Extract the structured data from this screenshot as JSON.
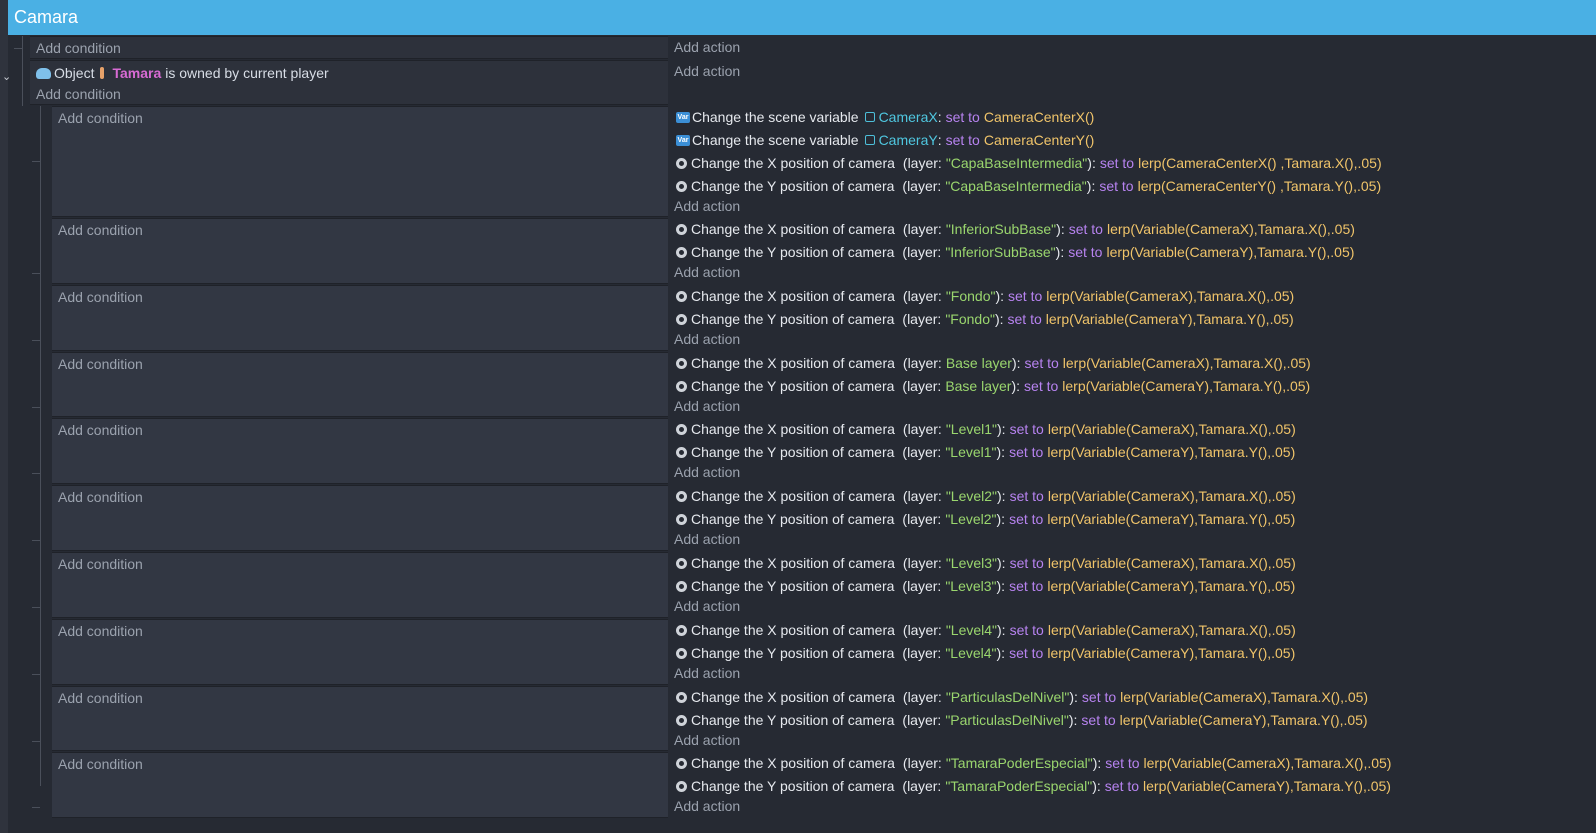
{
  "group": {
    "title": "Camara"
  },
  "labels": {
    "add_condition": "Add condition",
    "add_action": "Add action"
  },
  "icons": {
    "collapse": "chevron-down-icon",
    "object": "cloud-icon",
    "camera": "gear-icon",
    "variable": "variable-icon"
  },
  "top_event": {
    "add_condition": "Add condition",
    "add_action": "Add action"
  },
  "parent_event": {
    "condition": {
      "prefix": "Object",
      "object": "Tamara",
      "suffix": "is owned by current player"
    },
    "add_condition": "Add condition",
    "add_action": "Add action"
  },
  "sub_events": [
    {
      "actions": [
        {
          "kind": "var",
          "text": "Change the scene variable",
          "var": "CameraX",
          "set": "set to",
          "expr": "CameraCenterX()"
        },
        {
          "kind": "var",
          "text": "Change the scene variable",
          "var": "CameraY",
          "set": "set to",
          "expr": "CameraCenterY()"
        },
        {
          "kind": "cam",
          "text": "Change the X position of camera",
          "layer_pre": "(layer:",
          "layer": "\"CapaBaseIntermedia\"",
          "layer_post": "):",
          "set": "set to",
          "expr": "lerp(CameraCenterX() ,Tamara.X(),.05)"
        },
        {
          "kind": "cam",
          "text": "Change the Y position of camera",
          "layer_pre": "(layer:",
          "layer": "\"CapaBaseIntermedia\"",
          "layer_post": "):",
          "set": "set to",
          "expr": "lerp(CameraCenterY() ,Tamara.Y(),.05)"
        }
      ]
    },
    {
      "actions": [
        {
          "kind": "cam",
          "text": "Change the X position of camera",
          "layer_pre": "(layer:",
          "layer": "\"InferiorSubBase\"",
          "layer_post": "):",
          "set": "set to",
          "expr": "lerp(Variable(CameraX),Tamara.X(),.05)"
        },
        {
          "kind": "cam",
          "text": "Change the Y position of camera",
          "layer_pre": "(layer:",
          "layer": "\"InferiorSubBase\"",
          "layer_post": "):",
          "set": "set to",
          "expr": "lerp(Variable(CameraY),Tamara.Y(),.05)"
        }
      ]
    },
    {
      "actions": [
        {
          "kind": "cam",
          "text": "Change the X position of camera",
          "layer_pre": "(layer:",
          "layer": "\"Fondo\"",
          "layer_post": "):",
          "set": "set to",
          "expr": "lerp(Variable(CameraX),Tamara.X(),.05)"
        },
        {
          "kind": "cam",
          "text": "Change the Y position of camera",
          "layer_pre": "(layer:",
          "layer": "\"Fondo\"",
          "layer_post": "):",
          "set": "set to",
          "expr": "lerp(Variable(CameraY),Tamara.Y(),.05)"
        }
      ]
    },
    {
      "actions": [
        {
          "kind": "cam",
          "text": "Change the X position of camera",
          "layer_pre": "(layer:",
          "layer": "Base layer",
          "layer_post": "):",
          "set": "set to",
          "expr": "lerp(Variable(CameraX),Tamara.X(),.05)"
        },
        {
          "kind": "cam",
          "text": "Change the Y position of camera",
          "layer_pre": "(layer:",
          "layer": "Base layer",
          "layer_post": "):",
          "set": "set to",
          "expr": "lerp(Variable(CameraY),Tamara.Y(),.05)"
        }
      ]
    },
    {
      "actions": [
        {
          "kind": "cam",
          "text": "Change the X position of camera",
          "layer_pre": "(layer:",
          "layer": "\"Level1\"",
          "layer_post": "):",
          "set": "set to",
          "expr": "lerp(Variable(CameraX),Tamara.X(),.05)"
        },
        {
          "kind": "cam",
          "text": "Change the Y position of camera",
          "layer_pre": "(layer:",
          "layer": "\"Level1\"",
          "layer_post": "):",
          "set": "set to",
          "expr": "lerp(Variable(CameraY),Tamara.Y(),.05)"
        }
      ]
    },
    {
      "actions": [
        {
          "kind": "cam",
          "text": "Change the X position of camera",
          "layer_pre": "(layer:",
          "layer": "\"Level2\"",
          "layer_post": "):",
          "set": "set to",
          "expr": "lerp(Variable(CameraX),Tamara.X(),.05)"
        },
        {
          "kind": "cam",
          "text": "Change the Y position of camera",
          "layer_pre": "(layer:",
          "layer": "\"Level2\"",
          "layer_post": "):",
          "set": "set to",
          "expr": "lerp(Variable(CameraY),Tamara.Y(),.05)"
        }
      ]
    },
    {
      "actions": [
        {
          "kind": "cam",
          "text": "Change the X position of camera",
          "layer_pre": "(layer:",
          "layer": "\"Level3\"",
          "layer_post": "):",
          "set": "set to",
          "expr": "lerp(Variable(CameraX),Tamara.X(),.05)"
        },
        {
          "kind": "cam",
          "text": "Change the Y position of camera",
          "layer_pre": "(layer:",
          "layer": "\"Level3\"",
          "layer_post": "):",
          "set": "set to",
          "expr": "lerp(Variable(CameraY),Tamara.Y(),.05)"
        }
      ]
    },
    {
      "actions": [
        {
          "kind": "cam",
          "text": "Change the X position of camera",
          "layer_pre": "(layer:",
          "layer": "\"Level4\"",
          "layer_post": "):",
          "set": "set to",
          "expr": "lerp(Variable(CameraX),Tamara.X(),.05)"
        },
        {
          "kind": "cam",
          "text": "Change the Y position of camera",
          "layer_pre": "(layer:",
          "layer": "\"Level4\"",
          "layer_post": "):",
          "set": "set to",
          "expr": "lerp(Variable(CameraY),Tamara.Y(),.05)"
        }
      ]
    },
    {
      "actions": [
        {
          "kind": "cam",
          "text": "Change the X position of camera",
          "layer_pre": "(layer:",
          "layer": "\"ParticulasDelNivel\"",
          "layer_post": "):",
          "set": "set to",
          "expr": "lerp(Variable(CameraX),Tamara.X(),.05)"
        },
        {
          "kind": "cam",
          "text": "Change the Y position of camera",
          "layer_pre": "(layer:",
          "layer": "\"ParticulasDelNivel\"",
          "layer_post": "):",
          "set": "set to",
          "expr": "lerp(Variable(CameraY),Tamara.Y(),.05)"
        }
      ]
    },
    {
      "actions": [
        {
          "kind": "cam",
          "text": "Change the X position of camera",
          "layer_pre": "(layer:",
          "layer": "\"TamaraPoderEspecial\"",
          "layer_post": "):",
          "set": "set to",
          "expr": "lerp(Variable(CameraX),Tamara.X(),.05)"
        },
        {
          "kind": "cam",
          "text": "Change the Y position of camera",
          "layer_pre": "(layer:",
          "layer": "\"TamaraPoderEspecial\"",
          "layer_post": "):",
          "set": "set to",
          "expr": "lerp(Variable(CameraY),Tamara.Y(),.05)"
        }
      ]
    }
  ]
}
